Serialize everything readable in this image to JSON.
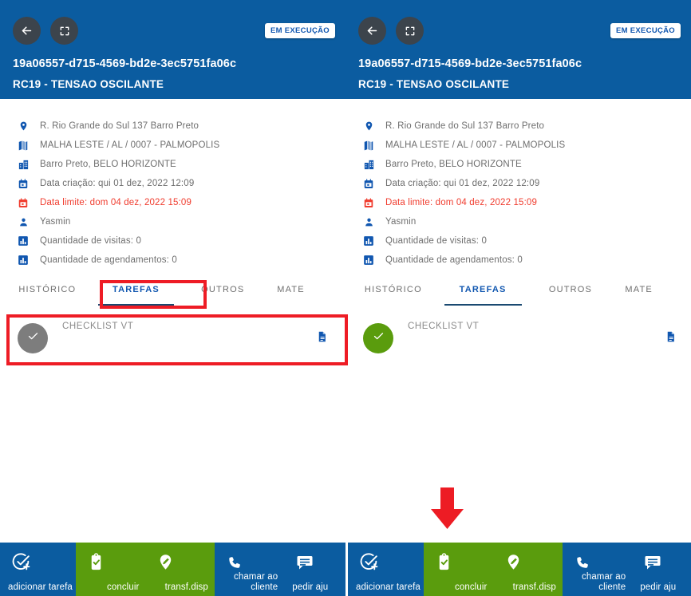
{
  "app": {
    "accent_blue": "#0b5ca0",
    "accent_green": "#5a9c0d",
    "highlight_red": "#ee1c25",
    "alert_red": "#f03c2e",
    "link_blue": "#1157b0",
    "grey_avatar": "#7d7d7d"
  },
  "header": {
    "back_icon": "arrow-left-icon",
    "expand_icon": "fullscreen-icon",
    "status_label": "EM EXECUÇÃO",
    "title": "19a06557-d715-4569-bd2e-3ec5751fa06c",
    "subtitle": "RC19 - TENSAO OSCILANTE"
  },
  "info": [
    {
      "icon": "location-pin-icon",
      "text": "R. Rio Grande do Sul 137 Barro Preto",
      "alert": false
    },
    {
      "icon": "map-icon",
      "text": "MALHA LESTE / AL / 0007 - PALMOPOLIS",
      "alert": false
    },
    {
      "icon": "building-icon",
      "text": "Barro Preto, BELO HORIZONTE",
      "alert": false
    },
    {
      "icon": "calendar-icon",
      "text": "Data criação: qui 01 dez, 2022 12:09",
      "alert": false
    },
    {
      "icon": "calendar-alert-icon",
      "text": "Data limite: dom 04 dez, 2022 15:09",
      "alert": true
    },
    {
      "icon": "person-icon",
      "text": "Yasmin",
      "alert": false
    },
    {
      "icon": "bar-chart-icon",
      "text": "Quantidade de visitas: 0",
      "alert": false
    },
    {
      "icon": "bar-chart-icon",
      "text": "Quantidade de agendamentos: 0",
      "alert": false
    }
  ],
  "tabs": [
    {
      "label": "HISTÓRICO",
      "active": false
    },
    {
      "label": "TAREFAS",
      "active": true
    },
    {
      "label": "OUTROS",
      "active": false
    },
    {
      "label": "MATE",
      "active": false
    }
  ],
  "task": {
    "label": "CHECKLIST VT",
    "status_icon": "check-icon",
    "document_icon": "document-icon",
    "left_avatar_state": "pending-grey",
    "right_avatar_state": "done-green"
  },
  "toolbar": [
    {
      "label": "adicionar tarefa",
      "icon": "add-task-icon",
      "color": "blue"
    },
    {
      "label": "concluir",
      "icon": "clipboard-check-icon",
      "color": "green"
    },
    {
      "label": "transf.disp",
      "icon": "transfer-pin-icon",
      "color": "green"
    },
    {
      "label": "chamar ao\ncliente",
      "icon": "phone-icon",
      "color": "blue"
    },
    {
      "label": "pedir aju",
      "icon": "chat-icon",
      "color": "blue"
    }
  ],
  "annotations": {
    "arrow_icon": "down-arrow-icon",
    "tab_highlight": "TAREFAS",
    "task_highlight": "CHECKLIST VT"
  }
}
